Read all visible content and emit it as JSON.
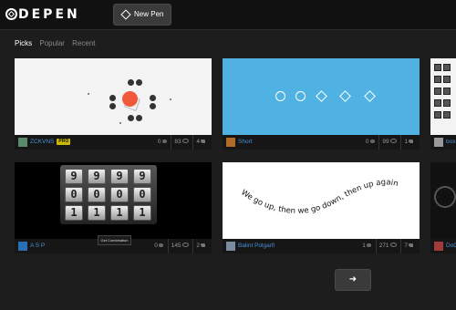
{
  "header": {
    "logo_text": "DEPEN",
    "new_pen_label": "New Pen"
  },
  "tabs": [
    {
      "label": "Picks"
    },
    {
      "label": "Popular"
    },
    {
      "label": "Recent"
    }
  ],
  "cards": [
    {
      "author": "ZCKVNS",
      "badge": "PRO",
      "comments": "0",
      "views": "83",
      "likes": "4"
    },
    {
      "author": "Short",
      "comments": "0",
      "views": "99",
      "likes": "1"
    },
    {
      "author": "box"
    },
    {
      "author": "A S P",
      "comments": "0",
      "views": "145",
      "likes": "2",
      "tooltip": "Get Combination",
      "digits": [
        "9",
        "9",
        "9",
        "9",
        "0",
        "0",
        "0",
        "0",
        "1",
        "1",
        "1",
        "1"
      ]
    },
    {
      "author": "Balint Polgarfi",
      "comments": "1",
      "views": "271",
      "likes": "7",
      "wave_text": "We go up, then we go down, then up again"
    },
    {
      "author": "DoO"
    }
  ],
  "pagination": {
    "next_label": "➜"
  },
  "colors": {
    "accent_link": "#4a90d9",
    "pro_badge": "#c9b800",
    "orange_circle": "#f05a3b",
    "blue_card": "#4fb2e3"
  }
}
